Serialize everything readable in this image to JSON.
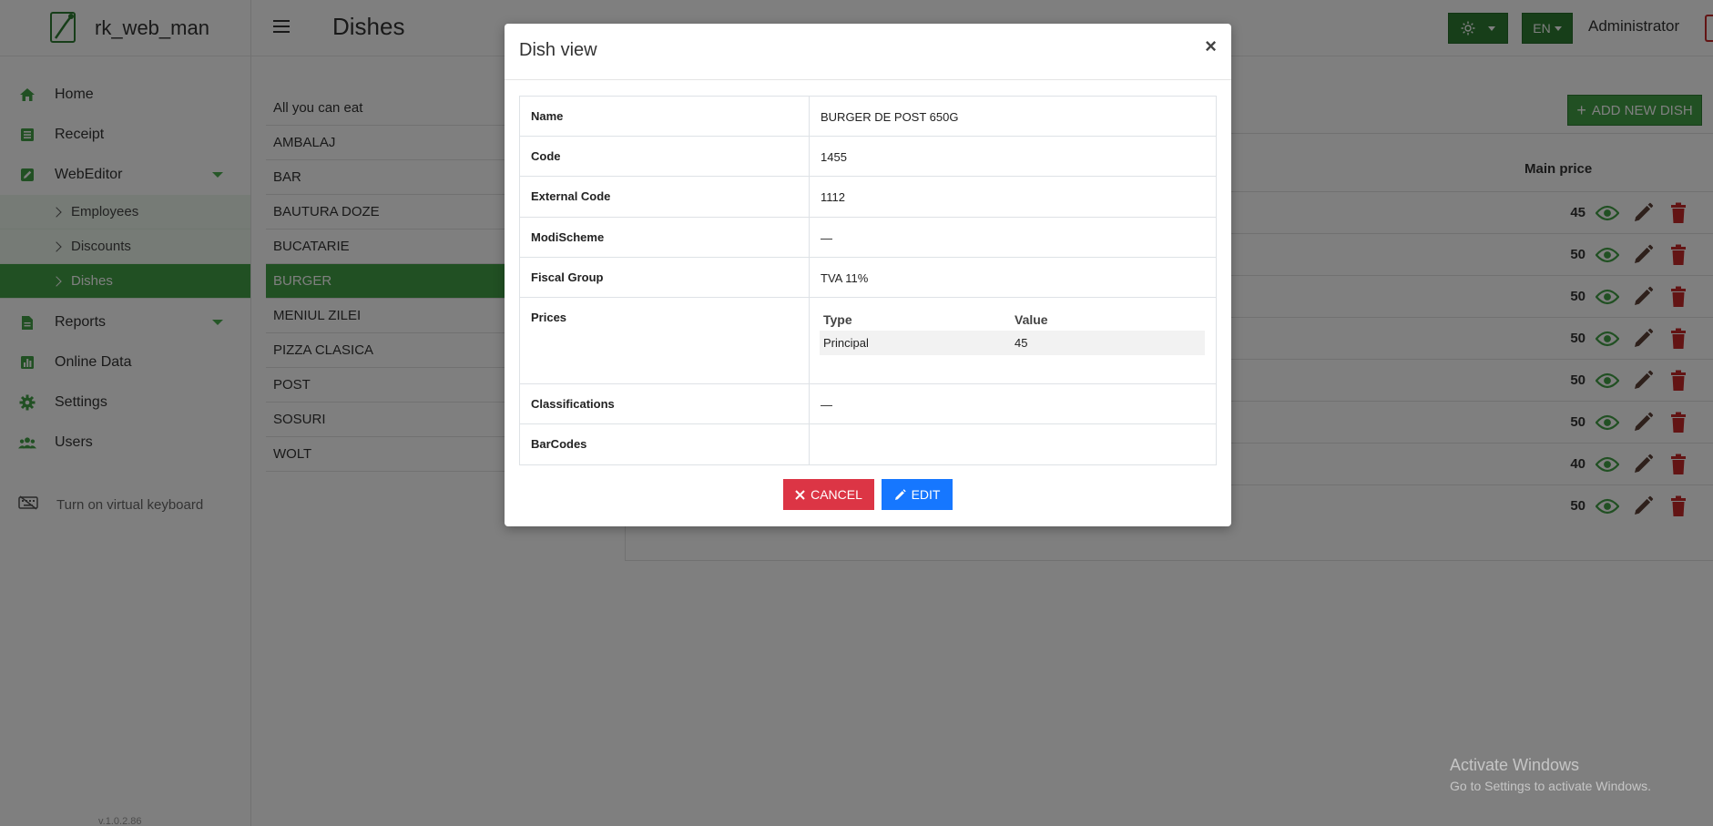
{
  "app": {
    "brand": "rk_web_man",
    "page_title": "Dishes",
    "user": "Administrator",
    "version": "v.1.0.2.86"
  },
  "header": {
    "language": "EN",
    "theme_icon": "sun-icon"
  },
  "sidebar": {
    "items": [
      {
        "label": "Home",
        "icon": "home-icon"
      },
      {
        "label": "Receipt",
        "icon": "receipt-icon"
      },
      {
        "label": "WebEditor",
        "icon": "edit-icon"
      },
      {
        "label": "Reports",
        "icon": "report-icon"
      },
      {
        "label": "Online Data",
        "icon": "chart-icon"
      },
      {
        "label": "Settings",
        "icon": "gear-icon"
      },
      {
        "label": "Users",
        "icon": "users-icon"
      }
    ],
    "webeditor_sub": [
      "Employees",
      "Discounts",
      "Dishes"
    ],
    "virtual_keyboard": "Turn on virtual keyboard"
  },
  "categories": [
    "All you can eat",
    "AMBALAJ",
    "BAR",
    "BAUTURA DOZE",
    "BUCATARIE",
    "BURGER",
    "MENIUL ZILEI",
    "PIZZA CLASICA",
    "POST",
    "SOSURI",
    "WOLT"
  ],
  "dish_table": {
    "add_button": "ADD NEW DISH",
    "price_header": "Main price",
    "prices": [
      "45",
      "50",
      "50",
      "50",
      "50",
      "50",
      "40",
      "50"
    ]
  },
  "modal": {
    "title": "Dish view",
    "close": "×",
    "rows": {
      "name": {
        "label": "Name",
        "value": "BURGER DE POST 650G"
      },
      "code": {
        "label": "Code",
        "value": "1455"
      },
      "external_code": {
        "label": "External Code",
        "value": "1112"
      },
      "modischeme": {
        "label": "ModiScheme",
        "value": "—"
      },
      "fiscal_group": {
        "label": "Fiscal Group",
        "value": "TVA 11%"
      },
      "prices": {
        "label": "Prices",
        "col_type": "Type",
        "col_value": "Value",
        "row_type": "Principal",
        "row_value": "45"
      },
      "classifications": {
        "label": "Classifications",
        "value": "—"
      },
      "barcodes": {
        "label": "BarCodes",
        "value": ""
      }
    },
    "cancel": "CANCEL",
    "edit": "EDIT"
  },
  "watermark": {
    "line1": "Activate Windows",
    "line2": "Go to Settings to activate Windows."
  },
  "colors": {
    "accent": "#43a047",
    "danger": "#dc3545",
    "primary": "#1677ff",
    "delete_icon": "#c62828",
    "edit_icon": "#5d4037"
  }
}
